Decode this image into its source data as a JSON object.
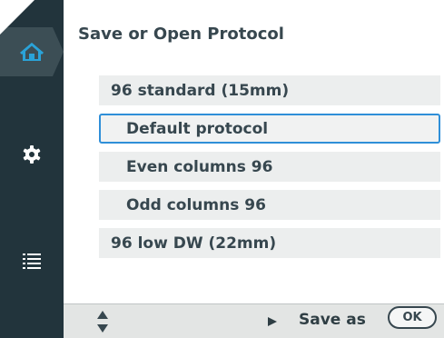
{
  "header": {
    "title": "Save or Open Protocol"
  },
  "sidebar": {
    "items": [
      {
        "icon": "home-icon",
        "active": true
      },
      {
        "icon": "gear-icon",
        "active": false
      },
      {
        "icon": "list-icon",
        "active": false
      }
    ]
  },
  "protocols": [
    {
      "label": "96 standard (15mm)"
    },
    {
      "label": "Default protocol",
      "selected": true
    },
    {
      "label": "Even columns 96"
    },
    {
      "label": "Odd columns 96"
    },
    {
      "label": "96 low DW (22mm)"
    }
  ],
  "footer": {
    "save_label": "Save as",
    "ok_label": "OK"
  },
  "colors": {
    "sidebar_bg": "#22343c",
    "selection_border": "#2f8fd8",
    "item_bg": "#eceeee",
    "text": "#37474f"
  }
}
